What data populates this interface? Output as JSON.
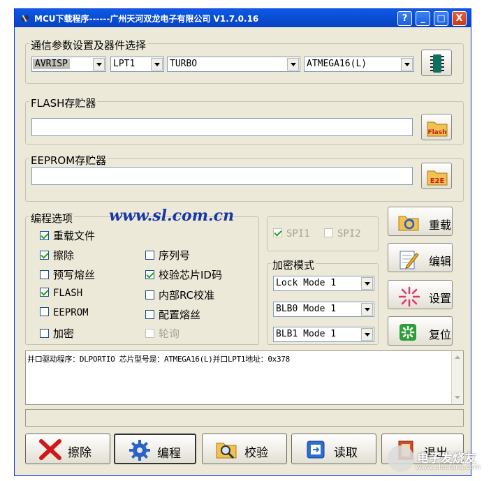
{
  "window": {
    "title": "MCU下载程序------广州天河双龙电子有限公司 V1.7.0.16",
    "help": "?",
    "minimize": "_",
    "maximize": "□",
    "close": "X"
  },
  "comm": {
    "legend": "通信参数设置及器件选择",
    "programmer": "AVRISP",
    "port": "LPT1",
    "speed": "TURBO",
    "device": "ATMEGA16(L)"
  },
  "flash": {
    "legend": "FLASH存贮器",
    "path": "",
    "button_label": "Flash"
  },
  "eeprom": {
    "legend": "EEPROM存贮器",
    "path": "",
    "button_label": "E2E"
  },
  "options": {
    "legend": "编程选项",
    "url": "www.sl.com.cn",
    "items": [
      {
        "label": "重载文件",
        "checked": true
      },
      {
        "label": "擦除",
        "checked": true
      },
      {
        "label": "预写熔丝",
        "checked": false
      },
      {
        "label": "FLASH",
        "checked": true
      },
      {
        "label": "EEPROM",
        "checked": false
      },
      {
        "label": "加密",
        "checked": false
      },
      {
        "label": "序列号",
        "checked": false
      },
      {
        "label": "校验芯片ID码",
        "checked": true
      },
      {
        "label": "内部RC校准",
        "checked": false
      },
      {
        "label": "配置熔丝",
        "checked": false
      },
      {
        "label": "轮询",
        "checked": false
      }
    ]
  },
  "spi": {
    "spi1": "SPI1",
    "spi2": "SPI2"
  },
  "encrypt": {
    "legend": "加密模式",
    "lock": "Lock Mode 1",
    "blb0": "BLB0 Mode 1",
    "blb1": "BLB1 Mode 1"
  },
  "side_buttons": {
    "reload": "重载",
    "edit": "编辑",
    "settings": "设置",
    "reset": "复位"
  },
  "status": {
    "message": "并口驱动程序：DLPORTIO  芯片型号是：ATMEGA16(L)并口LPT1地址：0x378",
    "bar": ""
  },
  "bottom_buttons": {
    "erase": "擦除",
    "program": "编程",
    "verify": "校验",
    "read": "读取",
    "exit": "退出"
  },
  "watermark": {
    "main": "电子发烧友",
    "sub": "www.elecfans.com"
  },
  "colors": {
    "title_blue": "#0a4fd6",
    "window_bg": "#ece9d8",
    "url_blue": "#1736a8",
    "close_red": "#c53a12"
  }
}
